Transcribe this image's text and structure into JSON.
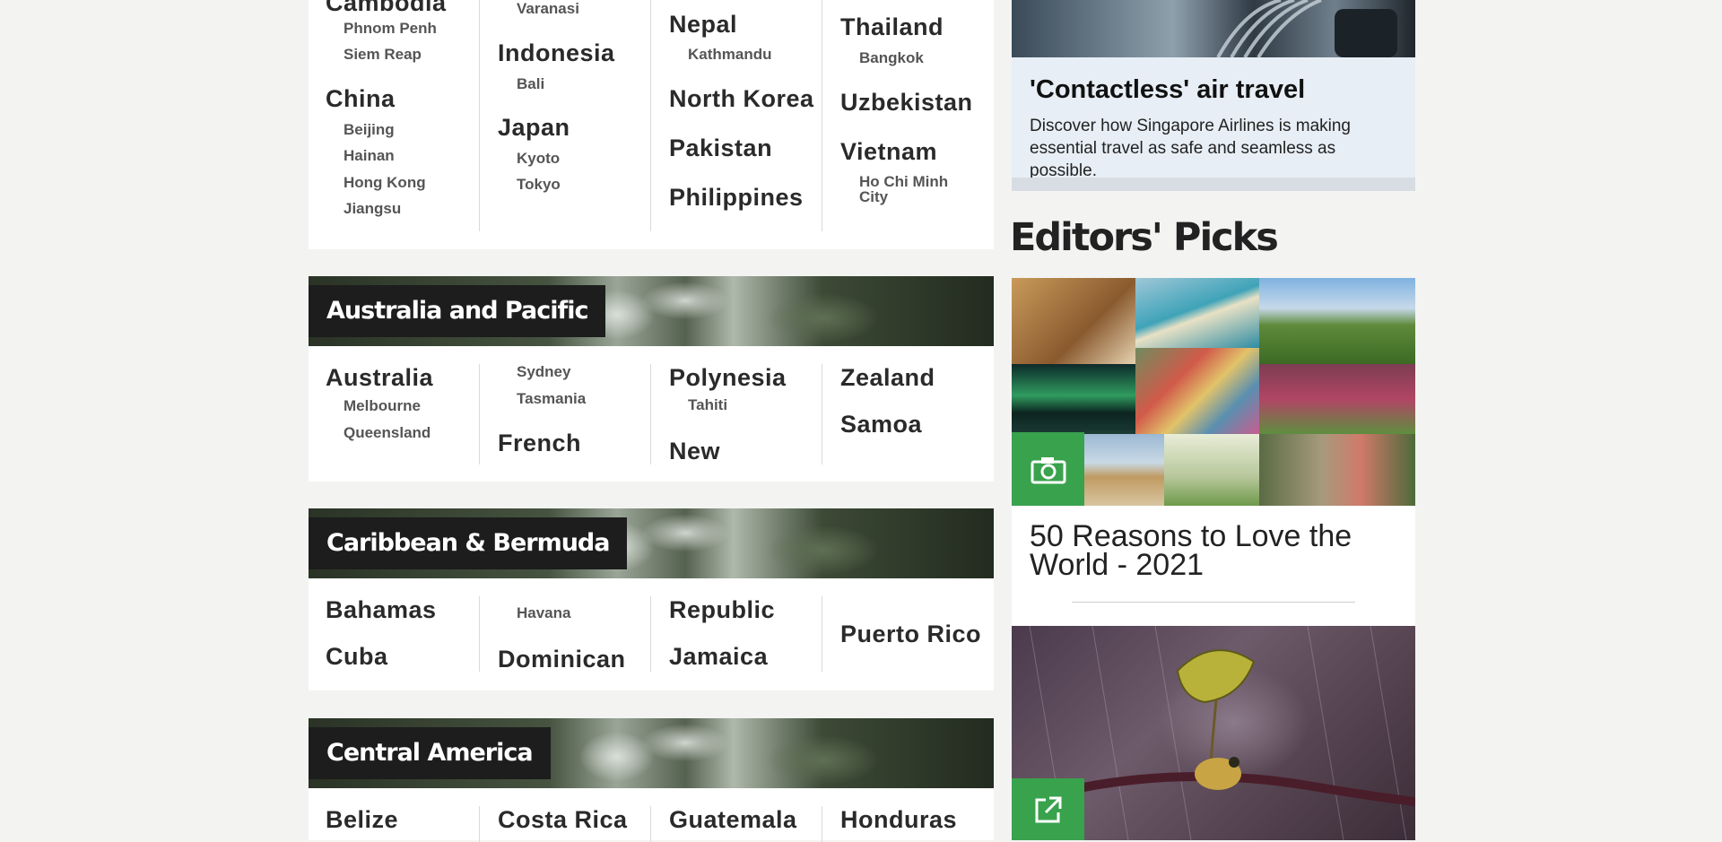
{
  "asia": {
    "countries": [
      "Cambodia",
      "Indonesia",
      "China",
      "Japan",
      "Nepal",
      "North Korea",
      "Pakistan",
      "Philippines",
      "Thailand",
      "Uzbekistan",
      "Vietnam"
    ],
    "cities": [
      "Varanasi",
      "Phnom Penh",
      "Siem Reap",
      "Bali",
      "Beijing",
      "Hainan",
      "Hong Kong",
      "Jiangsu",
      "Kyoto",
      "Tokyo",
      "Kathmandu",
      "Bangkok",
      "Ho Chi Minh City"
    ]
  },
  "pacific": {
    "title": "Australia and Pacific",
    "countries": [
      "Australia",
      "Polynesia",
      "Zealand",
      "Samoa",
      "French",
      "New"
    ],
    "cities": [
      "Sydney",
      "Tasmania",
      "Melbourne",
      "Queensland",
      "Tahiti"
    ]
  },
  "caribbean": {
    "title": "Caribbean & Bermuda",
    "countries": [
      "Bahamas",
      "Cuba",
      "Dominican",
      "Republic",
      "Jamaica",
      "Puerto Rico"
    ],
    "cities": [
      "Havana"
    ]
  },
  "central": {
    "title": "Central America",
    "countries": [
      "Belize",
      "Costa Rica",
      "Guatemala",
      "Honduras"
    ]
  },
  "promo": {
    "title": "'Contactless' air travel",
    "text": "Discover how Singapore Airlines is making essential travel as safe and seamless as possible."
  },
  "editors_picks": {
    "heading": "Editors' Picks",
    "gallery_title": "50 Reasons to Love the World - 2021",
    "icons": [
      "camera-icon",
      "external-link-icon"
    ]
  },
  "colors": {
    "accent_green": "#39a24d",
    "banner_label_bg": "#1d1d1d",
    "promo_bg": "#e7eef5"
  }
}
